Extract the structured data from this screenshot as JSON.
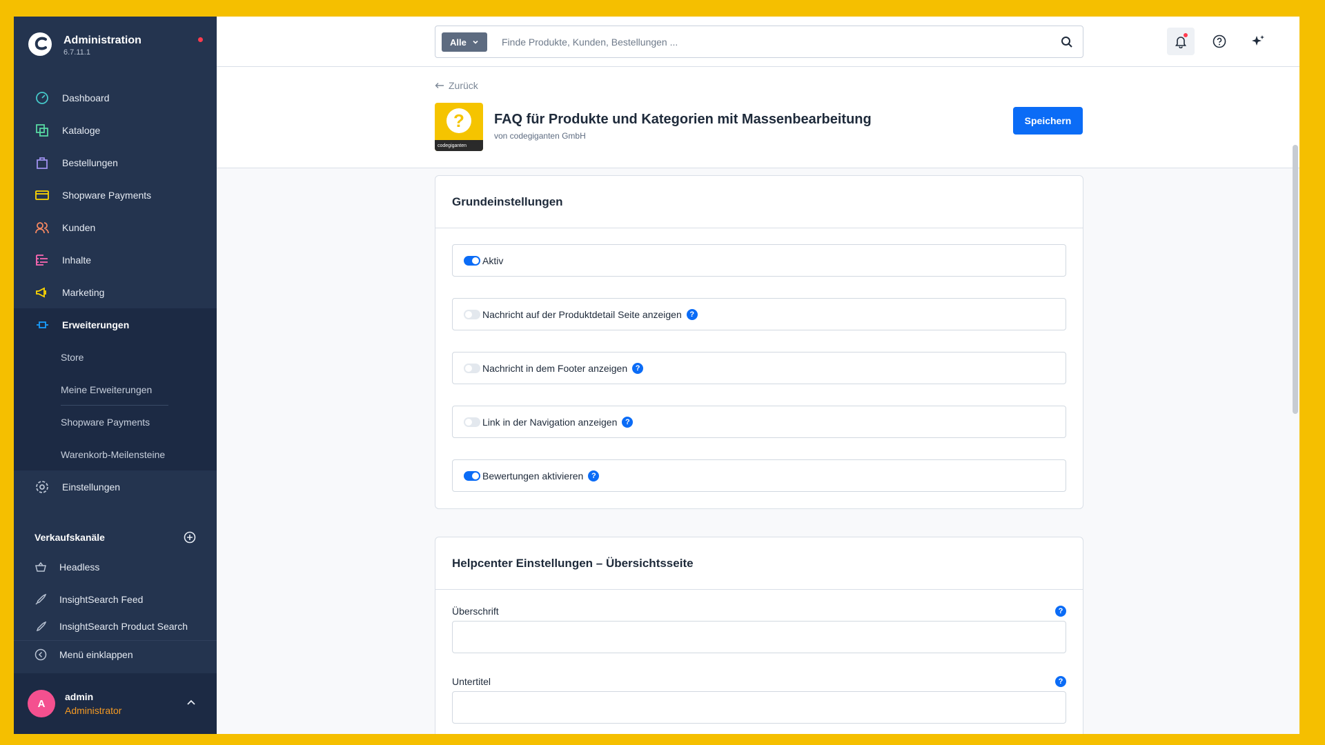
{
  "brand": {
    "title": "Administration",
    "version": "6.7.11.1"
  },
  "nav": {
    "items": [
      {
        "label": "Dashboard",
        "icon": "dashboard-icon",
        "color": "#45c8c9"
      },
      {
        "label": "Kataloge",
        "icon": "catalogues-icon",
        "color": "#57d9a3"
      },
      {
        "label": "Bestellungen",
        "icon": "orders-icon",
        "color": "#a092f0"
      },
      {
        "label": "Shopware Payments",
        "icon": "payments-icon",
        "color": "#ffd700"
      },
      {
        "label": "Kunden",
        "icon": "customers-icon",
        "color": "#f88962"
      },
      {
        "label": "Inhalte",
        "icon": "content-icon",
        "color": "#ff68b4"
      },
      {
        "label": "Marketing",
        "icon": "marketing-icon",
        "color": "#ffd700"
      },
      {
        "label": "Erweiterungen",
        "icon": "extensions-icon",
        "color": "#189eff"
      }
    ],
    "sub_items": [
      "Store",
      "Meine Erweiterungen",
      "Shopware Payments",
      "Warenkorb-Meilensteine"
    ],
    "settings_label": "Einstellungen"
  },
  "channels": {
    "title": "Verkaufskanäle",
    "items": [
      "Headless",
      "InsightSearch Feed",
      "InsightSearch Product Search"
    ]
  },
  "collapse_label": "Menü einklappen",
  "user": {
    "initial": "A",
    "name": "admin",
    "role": "Administrator"
  },
  "search": {
    "type_label": "Alle",
    "placeholder": "Finde Produkte, Kunden, Bestellungen ..."
  },
  "header": {
    "back_label": "Zurück",
    "title": "FAQ für Produkte und Kategorien mit Massenbearbeitung",
    "vendor": "von codegiganten GmbH",
    "save_label": "Speichern",
    "icon_text": "codegiganten"
  },
  "card1": {
    "title": "Grundeinstellungen",
    "toggles": [
      {
        "label": "Aktiv",
        "on": true,
        "help": false
      },
      {
        "label": "Nachricht auf der Produktdetail Seite anzeigen",
        "on": false,
        "help": true
      },
      {
        "label": "Nachricht in dem Footer anzeigen",
        "on": false,
        "help": true
      },
      {
        "label": "Link in der Navigation anzeigen",
        "on": false,
        "help": true
      },
      {
        "label": "Bewertungen aktivieren",
        "on": true,
        "help": true
      }
    ]
  },
  "card2": {
    "title": "Helpcenter Einstellungen – Übersichtsseite",
    "fields": [
      {
        "label": "Überschrift",
        "value": ""
      },
      {
        "label": "Untertitel",
        "value": ""
      }
    ]
  }
}
